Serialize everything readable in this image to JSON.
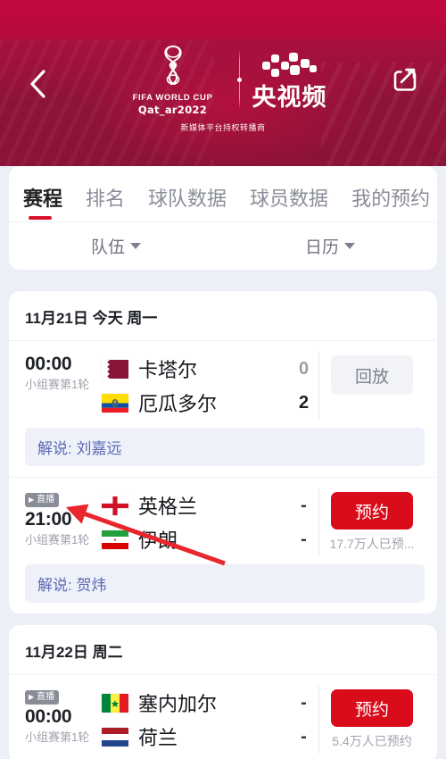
{
  "header": {
    "back_icon": "chevron-left-icon",
    "share_icon": "share-external-icon",
    "fifa_line1": "FIFA WORLD CUP",
    "fifa_line2": "Qat_ar2022",
    "cctv_title": "央视频",
    "subtitle": "新媒体平台持权转播商"
  },
  "tabs": [
    {
      "label": "赛程",
      "active": true
    },
    {
      "label": "排名",
      "active": false
    },
    {
      "label": "球队数据",
      "active": false
    },
    {
      "label": "球员数据",
      "active": false
    },
    {
      "label": "我的预约",
      "active": false
    }
  ],
  "filters": [
    {
      "label": "队伍",
      "icon": "chevron-down-icon"
    },
    {
      "label": "日历",
      "icon": "chevron-down-icon"
    }
  ],
  "days": [
    {
      "date_label": "11月21日 今天 周一",
      "matches": [
        {
          "live_badge": null,
          "time": "00:00",
          "round": "小组赛第1轮",
          "home": {
            "name": "卡塔尔",
            "flag": "qatar-flag",
            "score": "0"
          },
          "away": {
            "name": "厄瓜多尔",
            "flag": "ecuador-flag",
            "score": "2"
          },
          "action": {
            "type": "replay",
            "label": "回放",
            "count": null
          },
          "commentary": "解说: 刘嘉远"
        },
        {
          "live_badge": "直播",
          "time": "21:00",
          "round": "小组赛第1轮",
          "home": {
            "name": "英格兰",
            "flag": "england-flag",
            "score": "-"
          },
          "away": {
            "name": "伊朗",
            "flag": "iran-flag",
            "score": "-"
          },
          "action": {
            "type": "book",
            "label": "预约",
            "count": "17.7万人已预..."
          },
          "commentary": "解说: 贺炜"
        }
      ]
    },
    {
      "date_label": "11月22日 周二",
      "matches": [
        {
          "live_badge": "直播",
          "time": "00:00",
          "round": "小组赛第1轮",
          "home": {
            "name": "塞内加尔",
            "flag": "senegal-flag",
            "score": "-"
          },
          "away": {
            "name": "荷兰",
            "flag": "netherlands-flag",
            "score": "-"
          },
          "action": {
            "type": "book",
            "label": "预约",
            "count": "5.4万人已预约"
          },
          "commentary": null
        }
      ]
    }
  ],
  "colors": {
    "brand_red": "#d80c1a",
    "header_top": "#c10a3e",
    "header_main": "#8e1338",
    "tab_active_underline": "#d9112a",
    "commentary_bg": "#eef1f9",
    "commentary_text": "#5b6ab4",
    "page_bg": "#eceff5",
    "annotation_arrow": "#e8262b"
  }
}
